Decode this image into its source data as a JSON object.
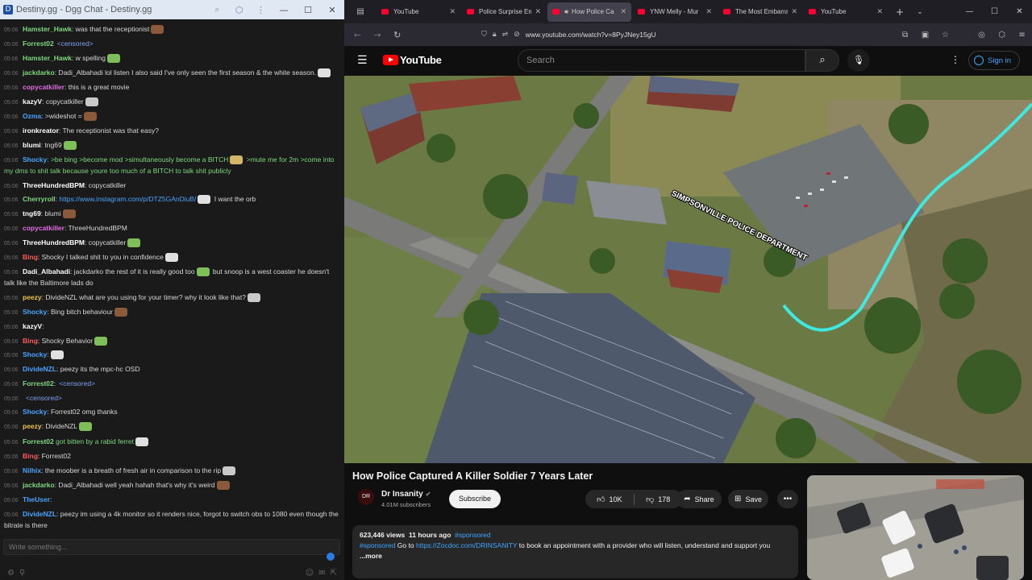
{
  "chat": {
    "window_title": "Destiny.gg - Dgg Chat - Destiny.gg",
    "input_placeholder": "Write something...",
    "messages": [
      {
        "time": "05:06",
        "user": "Hamster_Hawk",
        "user_color": "#7fd87f",
        "text": ": was that the receptionist"
      },
      {
        "time": "05:06",
        "user": "Forrest02",
        "user_color": "#7fd87f",
        "text": "",
        "extra": "<censored>",
        "extra_color": "#7f9ff0"
      },
      {
        "time": "05:06",
        "user": "Hamster_Hawk",
        "user_color": "#7fd87f",
        "text": ": w spelling"
      },
      {
        "time": "05:06",
        "user": "jackdarko",
        "user_color": "#7fd87f",
        "text": ": Dadi_Albahadi lol listen I also said I've only seen the first season & the white season."
      },
      {
        "time": "05:06",
        "user": "copycatkiller",
        "user_color": "#e26ce2",
        "text": ": this is a great movie"
      },
      {
        "time": "05:06",
        "user": "kazyV",
        "user_color": "#ffffff",
        "text": ": copycatkiller"
      },
      {
        "time": "05:06",
        "user": "Ozma",
        "user_color": "#4aa3ff",
        "text": ": >wideshot ="
      },
      {
        "time": "05:06",
        "user": "ironkreator",
        "user_color": "#ffffff",
        "text": ": The receptionist was that easy?"
      },
      {
        "time": "05:06",
        "user": "blumi",
        "user_color": "#ffffff",
        "text": ": tng69"
      },
      {
        "time": "05:06",
        "user": "Shocky",
        "user_color": "#4aa3ff",
        "text": ": >be bing >become mod >simultaneously become a BITCH",
        "text_color": "#7fd87f",
        "text2": " >mute me for 2m >come into my dms to shit talk because youre too much of a BITCH to talk shit publicly",
        "wrap": true
      },
      {
        "time": "05:06",
        "user": "ThreeHundredBPM",
        "user_color": "#ffffff",
        "text": ": copycatkiller"
      },
      {
        "time": "05:06",
        "user": "Cherryroll",
        "user_color": "#7fd87f",
        "text": ": ",
        "link": "https://www.instagram.com/p/DTZ5GAnDiuB/",
        "text2": " I want the orb"
      },
      {
        "time": "05:06",
        "user": "tng69",
        "user_color": "#ffffff",
        "text": ": blumi"
      },
      {
        "time": "05:06",
        "user": "copycatkiller",
        "user_color": "#e26ce2",
        "text": ": ThreeHundredBPM"
      },
      {
        "time": "05:06",
        "user": "ThreeHundredBPM",
        "user_color": "#ffffff",
        "text": ": copycatkiller"
      },
      {
        "time": "05:06",
        "user": "Bing",
        "user_color": "#ff5a5a",
        "text": ": Shocky I talked shit to you in confidence"
      },
      {
        "time": "05:06",
        "user": "Dadi_Albahadi",
        "user_color": "#ffffff",
        "text": ": jackdarko the rest of it is really good too",
        "text2": " but snoop is a west coaster he doesn't talk like the Baltimore lads do",
        "wrap": true
      },
      {
        "time": "05:06",
        "user": "peezy",
        "user_color": "#e8c14a",
        "text": ": DivideNZL what are you using for your timer? why it look like that?"
      },
      {
        "time": "05:06",
        "user": "Shocky",
        "user_color": "#4aa3ff",
        "text": ": Bing bitch behaviour"
      },
      {
        "time": "05:06",
        "user": "kazyV",
        "user_color": "#ffffff",
        "text": ":"
      },
      {
        "time": "05:06",
        "user": "Bing",
        "user_color": "#ff5a5a",
        "text": ": Shocky Behavior"
      },
      {
        "time": "05:06",
        "user": "Shocky",
        "user_color": "#4aa3ff",
        "text": ":"
      },
      {
        "time": "05:06",
        "user": "DivideNZL",
        "user_color": "#4aa3ff",
        "text": ": peezy its the mpc-hc OSD"
      },
      {
        "time": "05:06",
        "user": "Forrest02",
        "user_color": "#7fd87f",
        "text": ":",
        "extra": "<censored>",
        "extra_color": "#7f9ff0"
      },
      {
        "time": "05:06",
        "user": "",
        "user_color": "#7f9ff0",
        "text": "",
        "extra": "<censored>",
        "extra_color": "#7f9ff0"
      },
      {
        "time": "05:06",
        "user": "Shocky",
        "user_color": "#4aa3ff",
        "text": ": Forrest02 omg thanks"
      },
      {
        "time": "05:06",
        "user": "peezy",
        "user_color": "#e8c14a",
        "text": ": DivideNZL"
      },
      {
        "time": "05:06",
        "user": "Forrest02",
        "user_color": "#7fd87f",
        "text": " got bitten by a rabid ferret",
        "text_color": "#7fd87f"
      },
      {
        "time": "05:06",
        "user": "Bing",
        "user_color": "#ff5a5a",
        "text": ": Forrest02"
      },
      {
        "time": "05:06",
        "user": "Nilhix",
        "user_color": "#4aa3ff",
        "text": ": the moober is a breath of fresh air in comparison to the rip"
      },
      {
        "time": "05:06",
        "user": "jackdarko",
        "user_color": "#7fd87f",
        "text": ": Dadi_Albahadi well yeah hahah that's why it's weird"
      },
      {
        "time": "05:06",
        "user": "TheUser",
        "user_color": "#4aa3ff",
        "text": ":"
      },
      {
        "time": "05:06",
        "user": "DivideNZL",
        "user_color": "#4aa3ff",
        "text": ": peezy im using a 4k monitor so it renders nice, forgot to switch obs to 1080 even though the bitrate is there",
        "wrap": true
      }
    ]
  },
  "browser": {
    "tabs": [
      {
        "label": "YouTube",
        "active": false,
        "audio": false
      },
      {
        "label": "Police Surprise Em",
        "active": false,
        "audio": false
      },
      {
        "label": "How Police Ca",
        "active": true,
        "audio": true
      },
      {
        "label": "YNW Melly - Mur",
        "active": false,
        "audio": false
      },
      {
        "label": "The Most Embarra",
        "active": false,
        "audio": false
      },
      {
        "label": "YouTube",
        "active": false,
        "audio": false
      }
    ],
    "url": "www.youtube.com/watch?v=8PyJNey15gU"
  },
  "youtube": {
    "logo_text": "YouTube",
    "search_placeholder": "Search",
    "signin_label": "Sign in",
    "video": {
      "overlay_text": "SIMPSONVILLE POLICE DEPARTMENT",
      "route_color": "#3fe8e0"
    },
    "title": "How Police Captured A Killer Soldier 7 Years Later",
    "channel": {
      "avatar_text": "DR",
      "name": "Dr Insanity",
      "subscribers": "4.01M subscribers",
      "subscribe_label": "Subscribe"
    },
    "actions": {
      "likes": "10K",
      "dislikes": "178",
      "share": "Share",
      "save": "Save",
      "more": "•••"
    },
    "description": {
      "views": "623,446 views",
      "age": "11 hours ago",
      "tag": "#sponsored",
      "line_prefix": "#sponsored",
      "line_text1": " Go to ",
      "link": "https://Zocdoc.com/DRINSANITY",
      "line_text2": " to book an appointment with a provider who will listen, understand and support you",
      "more_label": "...more"
    }
  },
  "colors": {
    "chat_bg": "#1a1a1a",
    "yt_red": "#ff0000",
    "yt_blue": "#3ea6ff"
  }
}
